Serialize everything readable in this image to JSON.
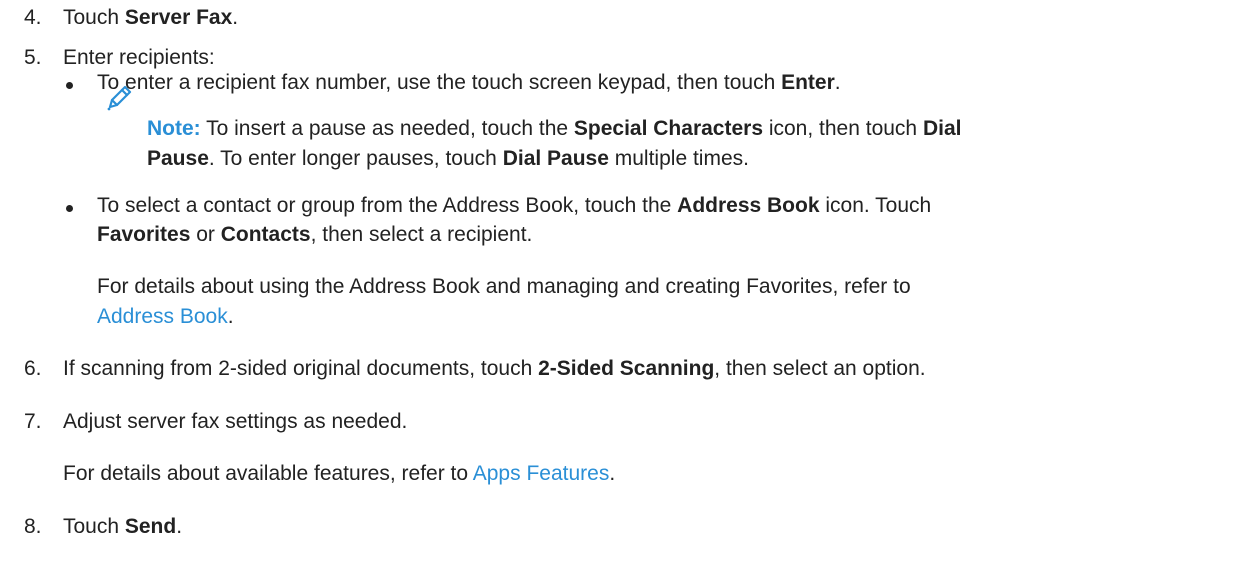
{
  "steps": {
    "s4": {
      "num": "4.",
      "pre": "Touch ",
      "bold": "Server Fax",
      "post": "."
    },
    "s5": {
      "num": "5.",
      "text": "Enter recipients:",
      "b1": {
        "pre": "To enter a recipient fax number, use the touch screen keypad, then touch ",
        "bold": "Enter",
        "post": "."
      },
      "note": {
        "label": "Note:",
        "l1_pre": " To insert a pause as needed, touch the ",
        "l1_bold1": "Special Characters",
        "l1_mid": " icon, then touch ",
        "l1_bold2": "Dial",
        "l2_bold1": "Pause",
        "l2_mid": ". To enter longer pauses, touch ",
        "l2_bold2": "Dial Pause",
        "l2_post": " multiple times."
      },
      "b2": {
        "l1_pre": "To select a contact or group from the Address Book, touch the ",
        "l1_bold": "Address Book",
        "l1_post": " icon. Touch",
        "l2_bold1": "Favorites",
        "l2_mid": " or ",
        "l2_bold2": "Contacts",
        "l2_post": ", then select a recipient."
      },
      "details": {
        "l1": "For details about using the Address Book and managing and creating Favorites, refer to",
        "link": "Address Book",
        "post": "."
      }
    },
    "s6": {
      "num": "6.",
      "pre": "If scanning from 2-sided original documents, touch ",
      "bold": "2-Sided Scanning",
      "post": ", then select an option."
    },
    "s7": {
      "num": "7.",
      "text": "Adjust server fax settings as needed.",
      "details_pre": "For details about available features, refer to ",
      "link": "Apps Features",
      "post": "."
    },
    "s8": {
      "num": "8.",
      "pre": "Touch ",
      "bold": "Send",
      "post": "."
    }
  },
  "colors": {
    "text": "#222222",
    "link": "#2a8fd6",
    "note_icon": "#2a8fd6"
  },
  "icons": {
    "note": "pencil-icon"
  }
}
